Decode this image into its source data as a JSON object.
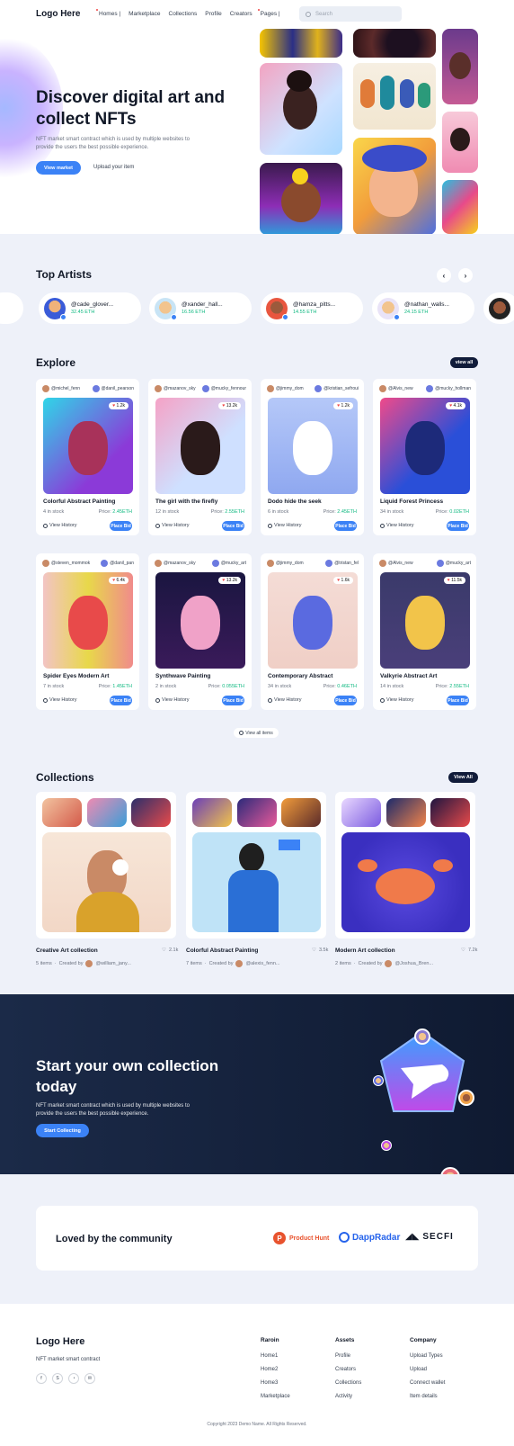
{
  "nav": {
    "logo": "Logo Here",
    "links": [
      "Homes |",
      "Marketplace",
      "Collections",
      "Profile",
      "Creators",
      "Pages |"
    ],
    "search_placeholder": "Search"
  },
  "hero": {
    "title": "Discover digital art and collect NFTs",
    "subtitle": "NFT market smart contract which is used by multiple websites to provide the users the best possible experience.",
    "primary": "View market",
    "secondary": "Upload your item"
  },
  "artists": {
    "title": "Top Artists",
    "items": [
      {
        "name": "@cade_glover...",
        "eth": "32.45 ETH"
      },
      {
        "name": "@xander_hall...",
        "eth": "16.56 ETH"
      },
      {
        "name": "@hamza_pitts...",
        "eth": "14.55 ETH"
      },
      {
        "name": "@nathan_walls...",
        "eth": "24.15 ETH"
      }
    ]
  },
  "explore": {
    "title": "Explore",
    "view_all": "view all",
    "view_all_items": "View all items",
    "stock_label": "in stock",
    "price_label": "Price:",
    "history": "View History",
    "bid": "Place Bid",
    "cards": [
      {
        "o1": "@michel_fenn",
        "o2": "@danil_pearson",
        "likes": "1.2k",
        "title": "Colorful Abstract Painting",
        "stock": "4 in stock",
        "price": "2.45ETH"
      },
      {
        "o1": "@mazanov_sky",
        "o2": "@mucky_fennour",
        "likes": "13.2k",
        "title": "The girl with the firefly",
        "stock": "12 in stock",
        "price": "2.55ETH"
      },
      {
        "o1": "@jimmy_dom",
        "o2": "@kristian_sefroui",
        "likes": "1.2k",
        "title": "Dodo hide the seek",
        "stock": "6 in stock",
        "price": "2.45ETH"
      },
      {
        "o1": "@Alvis_new",
        "o2": "@mucky_hollman",
        "likes": "4.1k",
        "title": "Liquid Forest Princess",
        "stock": "34 in stock",
        "price": "0.02ETH"
      },
      {
        "o1": "@steven_mommok",
        "o2": "@danil_pan",
        "likes": "6.4k",
        "title": "Spider Eyes Modern Art",
        "stock": "7 in stock",
        "price": "1.45ETH"
      },
      {
        "o1": "@mazanov_sky",
        "o2": "@mucky_art",
        "likes": "13.2k",
        "title": "Synthwave Painting",
        "stock": "2 in stock",
        "price": "0.055ETH"
      },
      {
        "o1": "@jimmy_dom",
        "o2": "@tristan_fel",
        "likes": "1.6k",
        "title": "Contemporary Abstract",
        "stock": "34 in stock",
        "price": "0.46ETH"
      },
      {
        "o1": "@Alvis_new",
        "o2": "@mucky_art",
        "likes": "11.5k",
        "title": "Valkyrie Abstract Art",
        "stock": "14 in stock",
        "price": "2.55ETH"
      }
    ]
  },
  "collections": {
    "title": "Collections",
    "view_all": "View All",
    "created_by": "Created by",
    "items": [
      {
        "title": "Creative Art collection",
        "likes": "2.1k",
        "count": "5 items",
        "author": "@william_jany..."
      },
      {
        "title": "Colorful Abstract Painting",
        "likes": "3.5k",
        "count": "7 items",
        "author": "@alexis_fenn..."
      },
      {
        "title": "Modern Art collection",
        "likes": "7.2k",
        "count": "2 items",
        "author": "@Joshua_Bren..."
      }
    ]
  },
  "cta": {
    "title": "Start your own collection today",
    "subtitle": "NFT market smart contract which is used by multiple websites to provide the users the best possible experience.",
    "button": "Start Collecting"
  },
  "loved": {
    "title": "Loved by the community",
    "brands": [
      "Product Hunt",
      "DappRadar",
      "SECFI"
    ]
  },
  "footer": {
    "logo": "Logo Here",
    "tagline": "NFT market smart contract",
    "cols": [
      {
        "title": "Raroin",
        "links": [
          "Home1",
          "Home2",
          "Home3",
          "Marketplace"
        ]
      },
      {
        "title": "Assets",
        "links": [
          "Profile",
          "Creators",
          "Collections",
          "Activity"
        ]
      },
      {
        "title": "Company",
        "links": [
          "Upload Types",
          "Upload",
          "Connect wallet",
          "Item details"
        ]
      }
    ],
    "copyright": "Copyright 2023 Demo Name. All Rights Reserved."
  },
  "colors": {
    "accent": "#3b82f6",
    "dark": "#111c3a",
    "price_green": "#10b981"
  }
}
